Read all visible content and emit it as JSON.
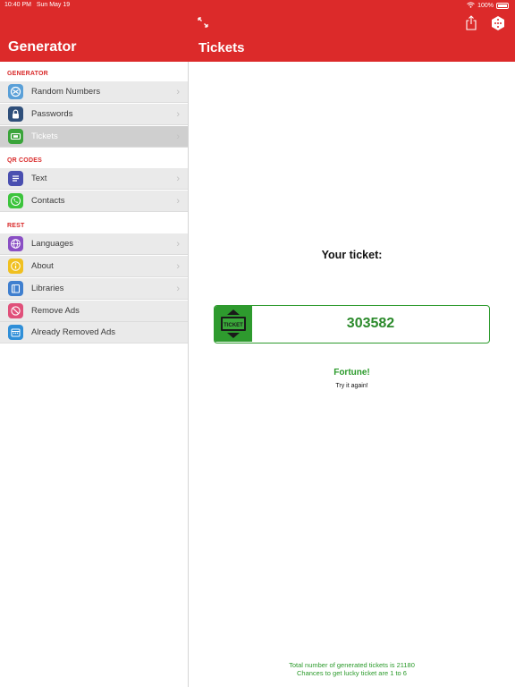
{
  "status_bar": {
    "time": "10:40 PM",
    "date": "Sun May 19",
    "battery": "100%",
    "icons": [
      "wifi-icon",
      "battery-icon"
    ]
  },
  "sidebar": {
    "title": "Generator",
    "sections": [
      {
        "title": "GENERATOR",
        "items": [
          {
            "label": "Random Numbers",
            "icon": "random-numbers-icon"
          },
          {
            "label": "Passwords",
            "icon": "lock-icon"
          },
          {
            "label": "Tickets",
            "icon": "ticket-icon",
            "selected": true
          }
        ]
      },
      {
        "title": "QR CODES",
        "items": [
          {
            "label": "Text",
            "icon": "text-icon"
          },
          {
            "label": "Contacts",
            "icon": "phone-icon"
          }
        ]
      },
      {
        "title": "REST",
        "items": [
          {
            "label": "Languages",
            "icon": "globe-icon"
          },
          {
            "label": "About",
            "icon": "info-icon"
          },
          {
            "label": "Libraries",
            "icon": "book-icon"
          },
          {
            "label": "Remove Ads",
            "icon": "no-ads-icon"
          },
          {
            "label": "Already Removed Ads",
            "icon": "calendar-icon"
          }
        ]
      }
    ]
  },
  "main": {
    "title": "Tickets",
    "your_ticket_label": "Your ticket:",
    "ticket_number": "303582",
    "result_title": "Fortune!",
    "result_subtitle": "Try it again!",
    "footer_line1": "Total number of generated tickets is 21180",
    "footer_line2": "Chances to get lucky ticket are 1 to 6",
    "toolbar_icons": [
      "expand-icon",
      "share-icon",
      "dice-icon"
    ]
  },
  "colors": {
    "brand_red": "#dc2a2a",
    "accent_green": "#2a9a2a",
    "row_background": "#eaeaea",
    "row_selected": "#cfcfcf"
  }
}
